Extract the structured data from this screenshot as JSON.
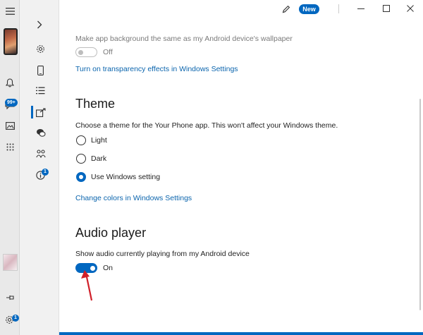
{
  "rail": {
    "menu_icon": "hamburger-icon",
    "notification_badge": "99+",
    "settings_badge": "1"
  },
  "nav": {
    "items": [
      {
        "icon": "chevron-right-icon"
      },
      {
        "icon": "gear-icon"
      },
      {
        "icon": "phone-icon"
      },
      {
        "icon": "list-icon"
      },
      {
        "icon": "phone-screen-icon"
      },
      {
        "icon": "chat-icon"
      },
      {
        "icon": "people-icon"
      },
      {
        "icon": "info-icon",
        "badge": "1"
      }
    ]
  },
  "titlebar": {
    "new_label": "New"
  },
  "wallpaper": {
    "label": "Make app background the same as my Android device's wallpaper",
    "state": "Off",
    "link": "Turn on transparency effects in Windows Settings"
  },
  "theme": {
    "title": "Theme",
    "description": "Choose a theme for the Your Phone app. This won't affect your Windows theme.",
    "options": [
      "Light",
      "Dark",
      "Use Windows setting"
    ],
    "selected": "Use Windows setting",
    "link": "Change colors in Windows Settings"
  },
  "audio": {
    "title": "Audio player",
    "description": "Show audio currently playing from my Android device",
    "state": "On"
  },
  "colors": {
    "accent": "#0067c0",
    "link": "#0a64ad",
    "annotation_arrow": "#d0202a"
  }
}
